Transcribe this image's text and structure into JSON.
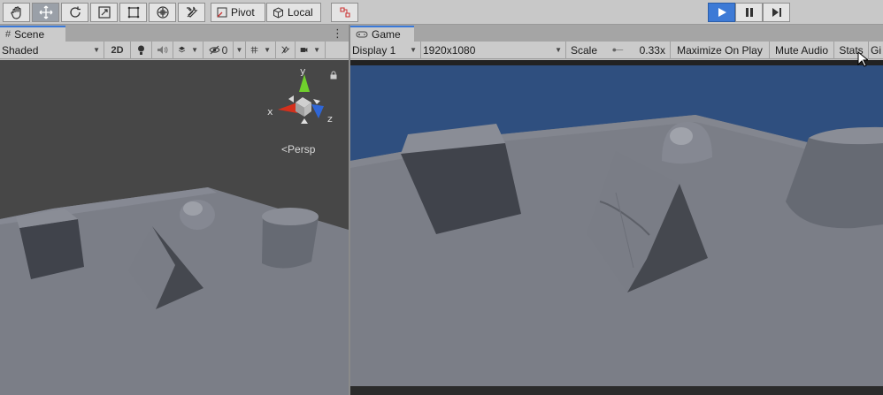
{
  "toolbar": {
    "tools": [
      {
        "icon": "hand-icon"
      },
      {
        "icon": "move-icon"
      },
      {
        "icon": "rotate-icon"
      },
      {
        "icon": "scale-icon"
      },
      {
        "icon": "rect-icon"
      },
      {
        "icon": "transform-icon"
      },
      {
        "icon": "custom-tool-icon"
      }
    ],
    "pivot_label": "Pivot",
    "local_label": "Local",
    "snap_icon": "grid-snap-icon",
    "play_icons": [
      "play-icon",
      "pause-icon",
      "step-icon"
    ],
    "accent": "#3d7ad6"
  },
  "scene_panel": {
    "tab_label": "Scene",
    "shading_mode": "Shaded",
    "mode_2d_label": "2D",
    "hidden_count": "0",
    "persp_label": "Persp",
    "gizmo": {
      "x": "x",
      "y": "y",
      "z": "z"
    }
  },
  "game_panel": {
    "tab_label": "Game",
    "display": "Display 1",
    "resolution": "1920x1080",
    "scale_label": "Scale",
    "scale_value": "0.33x",
    "maximize_label": "Maximize On Play",
    "mute_label": "Mute Audio",
    "stats_label": "Stats",
    "gizmos_label": "Gi"
  },
  "colors": {
    "ground": "#7b7e87",
    "sky": "#2f4f7f",
    "scene_bg": "#474747"
  }
}
